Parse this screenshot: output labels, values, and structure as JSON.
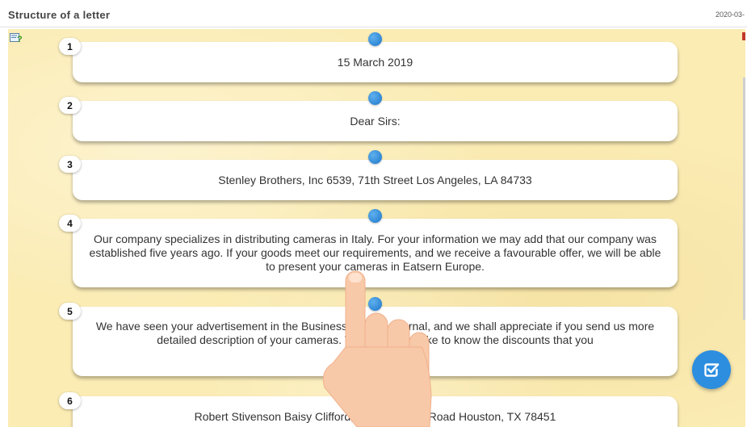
{
  "header": {
    "title": "Structure of a letter",
    "date": "2020-03-"
  },
  "icons": {
    "help": "help-icon",
    "check": "check-icon",
    "hand": "tap-hand-icon"
  },
  "colors": {
    "accent": "#2d8ee0",
    "board": "#fbecb4",
    "handle": "#1c76c8"
  },
  "items": [
    {
      "number": "1",
      "text": "15 March 2019"
    },
    {
      "number": "2",
      "text": "Dear Sirs:"
    },
    {
      "number": "3",
      "text": "Stenley Brothers, Inc 6539, 71th Street Los Angeles, LA 84733"
    },
    {
      "number": "4",
      "text": "Our company specializes in distributing cameras in Italy. For your information we may add that our company was established five years ago. If your goods meet our requirements, and we receive a favourable offer, we will be able to present your cameras in Eatsern Europe."
    },
    {
      "number": "5",
      "text": "We have seen your advertisement in the Business Weekly Journal, and we shall appreciate if you send us more detailed description of your cameras. We would also like to know the discounts that you"
    },
    {
      "number": "6",
      "text": "Robert Stivenson Baisy Clifford, Inc 3250, 2nd Road Houston, TX 78451"
    }
  ]
}
